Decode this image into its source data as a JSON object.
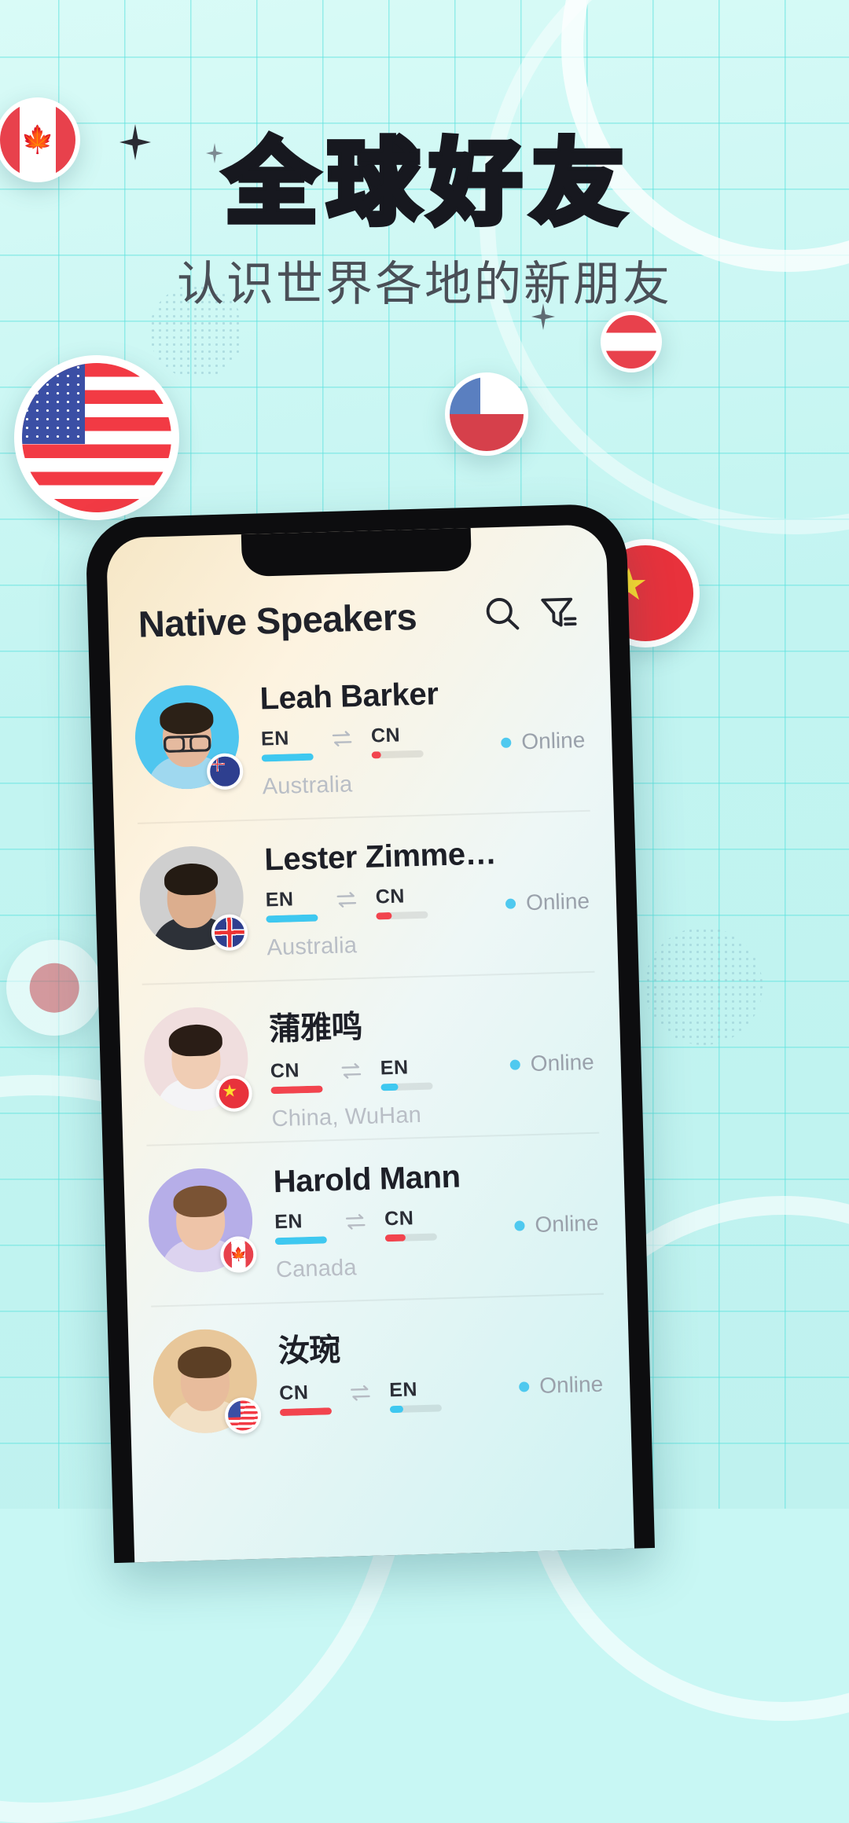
{
  "promo": {
    "headline": "全球好友",
    "subhead": "认识世界各地的新朋友"
  },
  "colors": {
    "page_bg": "#c2f4f1",
    "grid_line": "#5ce2de",
    "headline": "#17181f",
    "subhead": "#4a4f57",
    "accent_blue": "#3ec8f0",
    "accent_red": "#f2444e",
    "online": "#4fc9ef",
    "country_text": "#b9bec6"
  },
  "floating_flags": [
    {
      "name": "canada-flag-bubble",
      "code": "CA"
    },
    {
      "name": "united-states-flag-bubble",
      "code": "US"
    },
    {
      "name": "chile-flag-bubble",
      "code": "CL"
    },
    {
      "name": "austria-flag-bubble",
      "code": "AT"
    },
    {
      "name": "china-flag-bubble",
      "code": "CN"
    },
    {
      "name": "japan-flag-bubble",
      "code": "JP"
    }
  ],
  "phone": {
    "header": {
      "title": "Native Speakers",
      "search_icon": "search-icon",
      "filter_icon": "filter-icon"
    },
    "list": [
      {
        "name": "Leah Barker",
        "lang_from": "EN",
        "lang_to": "CN",
        "from_level": 100,
        "to_level": 18,
        "country": "Australia",
        "country_flag": "AU",
        "status": "Online"
      },
      {
        "name": "Lester Zimmerman",
        "lang_from": "EN",
        "lang_to": "CN",
        "from_level": 100,
        "to_level": 30,
        "country": "Australia",
        "country_flag": "GB",
        "status": "Online"
      },
      {
        "name": "蒲雅鸣",
        "lang_from": "CN",
        "lang_to": "EN",
        "from_level": 100,
        "to_level": 34,
        "country": "China, WuHan",
        "country_flag": "CN",
        "status": "Online"
      },
      {
        "name": "Harold Mann",
        "lang_from": "EN",
        "lang_to": "CN",
        "from_level": 100,
        "to_level": 40,
        "country": "Canada",
        "country_flag": "CA",
        "status": "Online"
      },
      {
        "name": "汝琬",
        "lang_from": "CN",
        "lang_to": "EN",
        "from_level": 100,
        "to_level": 26,
        "country": "",
        "country_flag": "US",
        "status": "Online"
      }
    ]
  }
}
